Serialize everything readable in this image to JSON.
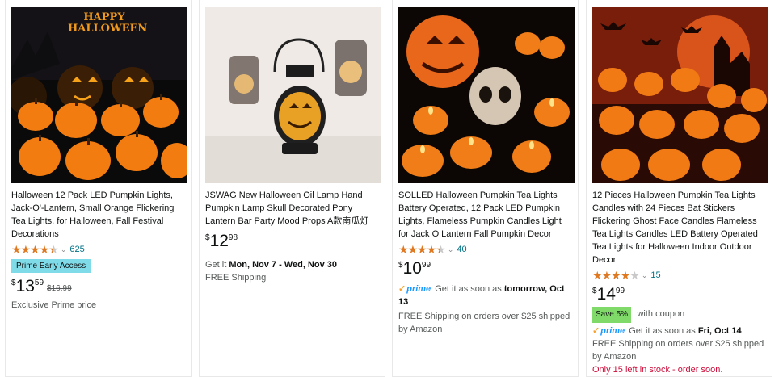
{
  "colors": {
    "star": "#de7921",
    "link": "#007185",
    "prime_blue": "#1a98ff",
    "early_access_bg": "#7fdbe8",
    "save_bg": "#7fda69",
    "stock_red": "#cc0c39"
  },
  "products": [
    {
      "image_text": "HAPPY HALLOWEEN",
      "title": "Halloween 12 Pack LED Pumpkin Lights, Jack-O'-Lantern, Small Orange Flickering Tea Lights, for Halloween, Fall Festival Decorations",
      "rating": 4.5,
      "rating_count": "625",
      "badge": "Prime Early Access",
      "price_currency": "$",
      "price_whole": "13",
      "price_fraction": "59",
      "list_price": "$16.99",
      "note": "Exclusive Prime price"
    },
    {
      "title": "JSWAG New Halloween Oil Lamp Hand Pumpkin Lamp Skull Decorated Pony Lantern Bar Party Mood Props A款南瓜灯",
      "price_currency": "$",
      "price_whole": "12",
      "price_fraction": "98",
      "delivery_prefix": "Get it",
      "delivery_dates": "Mon, Nov 7 - Wed, Nov 30",
      "shipping": "FREE Shipping"
    },
    {
      "title": "SOLLED Halloween Pumpkin Tea Lights Battery Operated, 12 Pack LED Pumpkin Lights, Flameless Pumpkin Candles Light for Jack O Lantern Fall Pumpkin Decor",
      "rating": 4.5,
      "rating_count": "40",
      "price_currency": "$",
      "price_whole": "10",
      "price_fraction": "99",
      "prime_label": "prime",
      "delivery_prefix": "Get it as soon as",
      "delivery_date": "tomorrow, Oct 13",
      "shipping": "FREE Shipping on orders over $25 shipped by Amazon"
    },
    {
      "title": "12 Pieces Halloween Pumpkin Tea Lights Candles with 24 Pieces Bat Stickers Flickering Ghost Face Candles Flameless Tea Lights Candles LED Battery Operated Tea Lights for Halloween Indoor Outdoor Decor",
      "rating": 4,
      "rating_count": "15",
      "price_currency": "$",
      "price_whole": "14",
      "price_fraction": "99",
      "save_badge": "Save 5%",
      "coupon_text": "with coupon",
      "prime_label": "prime",
      "delivery_prefix": "Get it as soon as",
      "delivery_date": "Fri, Oct 14",
      "shipping": "FREE Shipping on orders over $25 shipped by Amazon",
      "stock": "Only 15 left in stock - order soon."
    }
  ]
}
